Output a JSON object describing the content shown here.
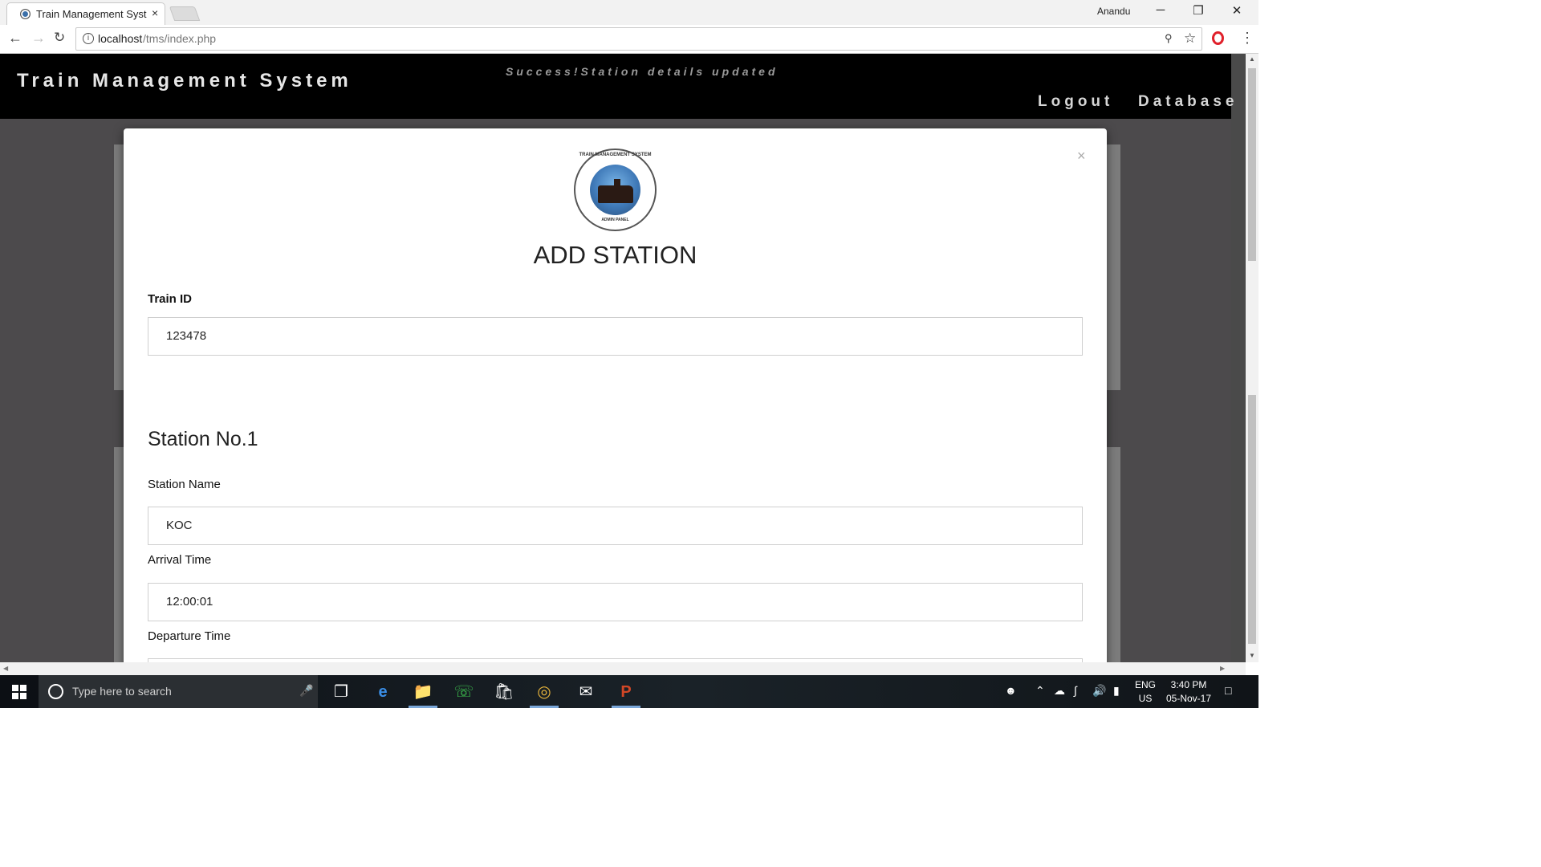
{
  "browser": {
    "tab_title": "Train Management Syste",
    "tab_close": "×",
    "profile_name": "Anandu",
    "url_host": "localhost",
    "url_path": "/tms/index.php",
    "window_controls": {
      "minimize": "─",
      "restore": "❐",
      "close": "✕"
    }
  },
  "site": {
    "title": "Train Management System",
    "flash_message": "Success!Station details updated",
    "nav": {
      "logout": "Logout",
      "database": "Database"
    }
  },
  "modal": {
    "close_symbol": "×",
    "logo_top_text": "TRAIN MANAGEMENT SYSTEM",
    "logo_bottom_text": "ADMIN PANEL",
    "title": "ADD STATION",
    "train_id": {
      "label": "Train ID",
      "value": "123478"
    },
    "section_title": "Station No.1",
    "station_name": {
      "label": "Station Name",
      "value": "KOC"
    },
    "arrival_time": {
      "label": "Arrival Time",
      "value": "12:00:01"
    },
    "departure_time": {
      "label": "Departure Time",
      "value": ""
    }
  },
  "taskbar": {
    "search_placeholder": "Type here to search",
    "language": "ENG",
    "region": "US",
    "time": "3:40 PM",
    "date": "05-Nov-17"
  },
  "colors": {
    "header_bg": "#000000",
    "backdrop": "#4c4a4c",
    "modal_bg": "#ffffff"
  }
}
